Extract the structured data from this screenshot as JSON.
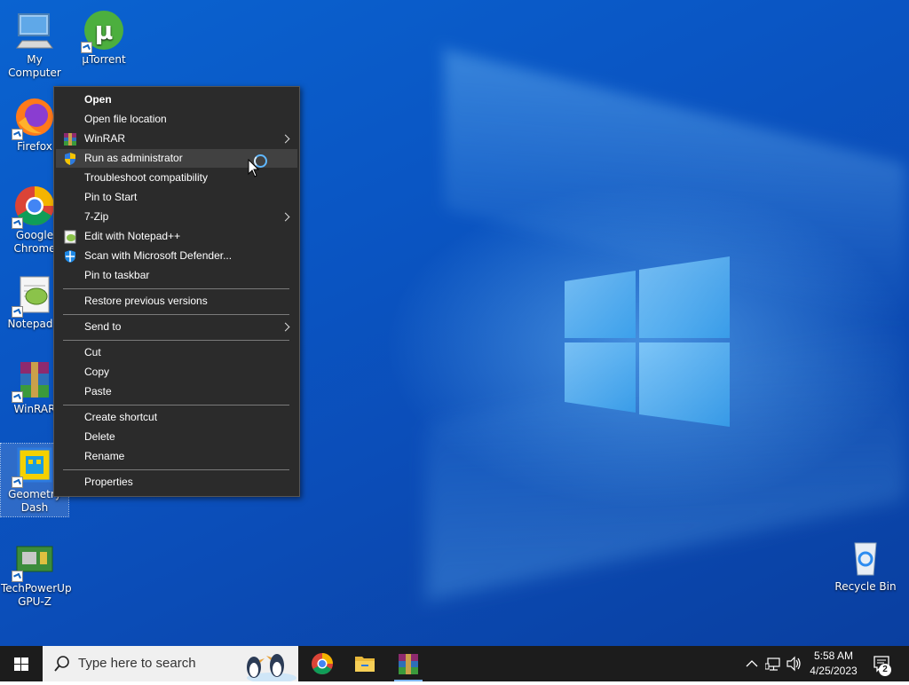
{
  "desktop": {
    "icons": [
      {
        "label": "My Computer"
      },
      {
        "label": "µTorrent"
      },
      {
        "label": "Firefox"
      },
      {
        "label": "Google Chrome"
      },
      {
        "label": "Notepad+"
      },
      {
        "label": "WinRAR"
      },
      {
        "label": "Geometry Dash"
      },
      {
        "label": "TechPowerUp GPU-Z"
      },
      {
        "label": "Recycle Bin"
      }
    ]
  },
  "context_menu": {
    "items": {
      "open": "Open",
      "open_file_location": "Open file location",
      "winrar": "WinRAR",
      "run_as_admin": "Run as administrator",
      "troubleshoot": "Troubleshoot compatibility",
      "pin_start": "Pin to Start",
      "seven_zip": "7-Zip",
      "notepadpp": "Edit with Notepad++",
      "defender": "Scan with Microsoft Defender...",
      "pin_taskbar": "Pin to taskbar",
      "restore": "Restore previous versions",
      "send_to": "Send to",
      "cut": "Cut",
      "copy": "Copy",
      "paste": "Paste",
      "create_shortcut": "Create shortcut",
      "delete": "Delete",
      "rename": "Rename",
      "properties": "Properties"
    },
    "hovered": "Run as administrator"
  },
  "taskbar": {
    "search_placeholder": "Type here to search",
    "apps": [
      "Google Chrome",
      "File Explorer",
      "WinRAR"
    ],
    "clock_time": "5:58 AM",
    "clock_date": "4/25/2023",
    "notification_count": "2"
  },
  "colors": {
    "menu_bg": "#2b2b2b",
    "menu_hover": "#414141",
    "taskbar_bg": "#1c1c1c",
    "desktop_blue": "#0a56c4"
  }
}
